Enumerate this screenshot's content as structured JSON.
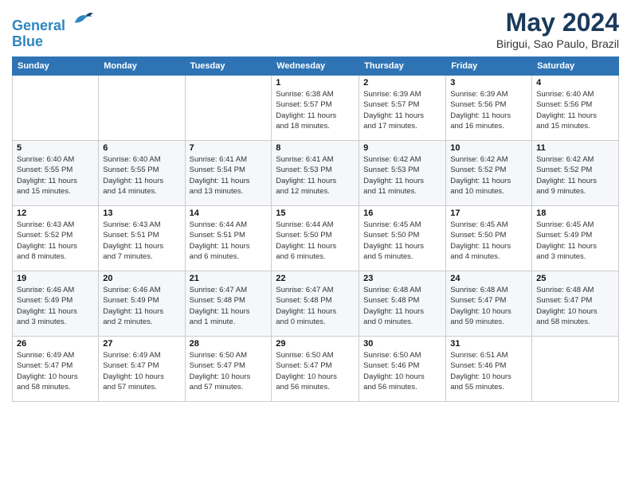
{
  "header": {
    "logo_line1": "General",
    "logo_line2": "Blue",
    "month_title": "May 2024",
    "location": "Birigui, Sao Paulo, Brazil"
  },
  "weekdays": [
    "Sunday",
    "Monday",
    "Tuesday",
    "Wednesday",
    "Thursday",
    "Friday",
    "Saturday"
  ],
  "weeks": [
    [
      {
        "day": "",
        "info": ""
      },
      {
        "day": "",
        "info": ""
      },
      {
        "day": "",
        "info": ""
      },
      {
        "day": "1",
        "info": "Sunrise: 6:38 AM\nSunset: 5:57 PM\nDaylight: 11 hours\nand 18 minutes."
      },
      {
        "day": "2",
        "info": "Sunrise: 6:39 AM\nSunset: 5:57 PM\nDaylight: 11 hours\nand 17 minutes."
      },
      {
        "day": "3",
        "info": "Sunrise: 6:39 AM\nSunset: 5:56 PM\nDaylight: 11 hours\nand 16 minutes."
      },
      {
        "day": "4",
        "info": "Sunrise: 6:40 AM\nSunset: 5:56 PM\nDaylight: 11 hours\nand 15 minutes."
      }
    ],
    [
      {
        "day": "5",
        "info": "Sunrise: 6:40 AM\nSunset: 5:55 PM\nDaylight: 11 hours\nand 15 minutes."
      },
      {
        "day": "6",
        "info": "Sunrise: 6:40 AM\nSunset: 5:55 PM\nDaylight: 11 hours\nand 14 minutes."
      },
      {
        "day": "7",
        "info": "Sunrise: 6:41 AM\nSunset: 5:54 PM\nDaylight: 11 hours\nand 13 minutes."
      },
      {
        "day": "8",
        "info": "Sunrise: 6:41 AM\nSunset: 5:53 PM\nDaylight: 11 hours\nand 12 minutes."
      },
      {
        "day": "9",
        "info": "Sunrise: 6:42 AM\nSunset: 5:53 PM\nDaylight: 11 hours\nand 11 minutes."
      },
      {
        "day": "10",
        "info": "Sunrise: 6:42 AM\nSunset: 5:52 PM\nDaylight: 11 hours\nand 10 minutes."
      },
      {
        "day": "11",
        "info": "Sunrise: 6:42 AM\nSunset: 5:52 PM\nDaylight: 11 hours\nand 9 minutes."
      }
    ],
    [
      {
        "day": "12",
        "info": "Sunrise: 6:43 AM\nSunset: 5:52 PM\nDaylight: 11 hours\nand 8 minutes."
      },
      {
        "day": "13",
        "info": "Sunrise: 6:43 AM\nSunset: 5:51 PM\nDaylight: 11 hours\nand 7 minutes."
      },
      {
        "day": "14",
        "info": "Sunrise: 6:44 AM\nSunset: 5:51 PM\nDaylight: 11 hours\nand 6 minutes."
      },
      {
        "day": "15",
        "info": "Sunrise: 6:44 AM\nSunset: 5:50 PM\nDaylight: 11 hours\nand 6 minutes."
      },
      {
        "day": "16",
        "info": "Sunrise: 6:45 AM\nSunset: 5:50 PM\nDaylight: 11 hours\nand 5 minutes."
      },
      {
        "day": "17",
        "info": "Sunrise: 6:45 AM\nSunset: 5:50 PM\nDaylight: 11 hours\nand 4 minutes."
      },
      {
        "day": "18",
        "info": "Sunrise: 6:45 AM\nSunset: 5:49 PM\nDaylight: 11 hours\nand 3 minutes."
      }
    ],
    [
      {
        "day": "19",
        "info": "Sunrise: 6:46 AM\nSunset: 5:49 PM\nDaylight: 11 hours\nand 3 minutes."
      },
      {
        "day": "20",
        "info": "Sunrise: 6:46 AM\nSunset: 5:49 PM\nDaylight: 11 hours\nand 2 minutes."
      },
      {
        "day": "21",
        "info": "Sunrise: 6:47 AM\nSunset: 5:48 PM\nDaylight: 11 hours\nand 1 minute."
      },
      {
        "day": "22",
        "info": "Sunrise: 6:47 AM\nSunset: 5:48 PM\nDaylight: 11 hours\nand 0 minutes."
      },
      {
        "day": "23",
        "info": "Sunrise: 6:48 AM\nSunset: 5:48 PM\nDaylight: 11 hours\nand 0 minutes."
      },
      {
        "day": "24",
        "info": "Sunrise: 6:48 AM\nSunset: 5:47 PM\nDaylight: 10 hours\nand 59 minutes."
      },
      {
        "day": "25",
        "info": "Sunrise: 6:48 AM\nSunset: 5:47 PM\nDaylight: 10 hours\nand 58 minutes."
      }
    ],
    [
      {
        "day": "26",
        "info": "Sunrise: 6:49 AM\nSunset: 5:47 PM\nDaylight: 10 hours\nand 58 minutes."
      },
      {
        "day": "27",
        "info": "Sunrise: 6:49 AM\nSunset: 5:47 PM\nDaylight: 10 hours\nand 57 minutes."
      },
      {
        "day": "28",
        "info": "Sunrise: 6:50 AM\nSunset: 5:47 PM\nDaylight: 10 hours\nand 57 minutes."
      },
      {
        "day": "29",
        "info": "Sunrise: 6:50 AM\nSunset: 5:47 PM\nDaylight: 10 hours\nand 56 minutes."
      },
      {
        "day": "30",
        "info": "Sunrise: 6:50 AM\nSunset: 5:46 PM\nDaylight: 10 hours\nand 56 minutes."
      },
      {
        "day": "31",
        "info": "Sunrise: 6:51 AM\nSunset: 5:46 PM\nDaylight: 10 hours\nand 55 minutes."
      },
      {
        "day": "",
        "info": ""
      }
    ]
  ]
}
